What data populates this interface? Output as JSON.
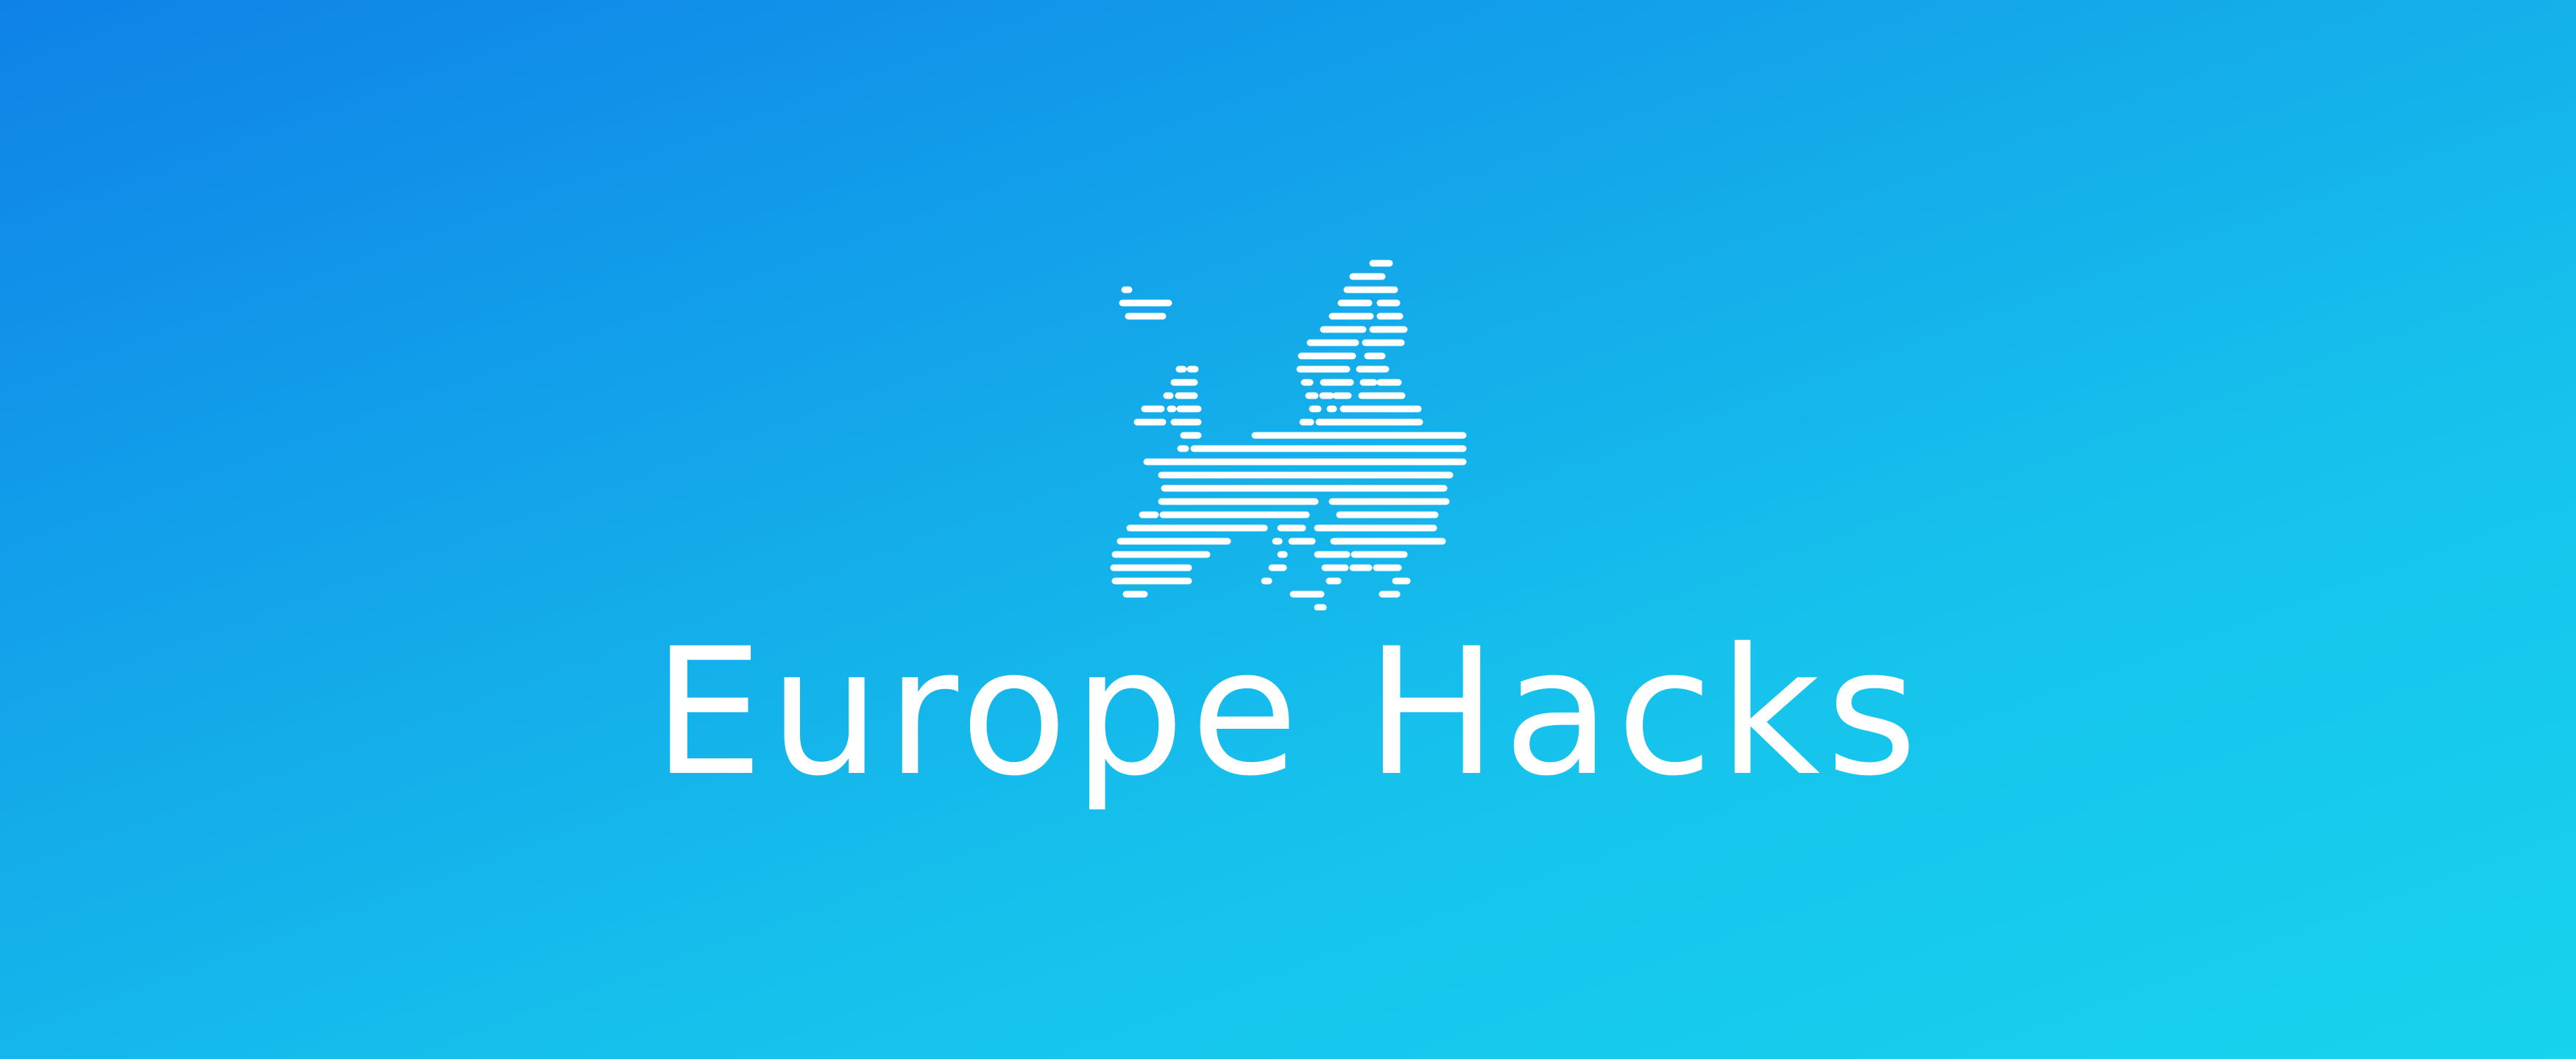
{
  "background": {
    "gradient_start": "#0f82e8",
    "gradient_end": "#17d3ee"
  },
  "logo": {
    "icon": "europe-map-icon",
    "color": "#ffffff"
  },
  "wordmark": {
    "text": "Europe Hacks"
  }
}
